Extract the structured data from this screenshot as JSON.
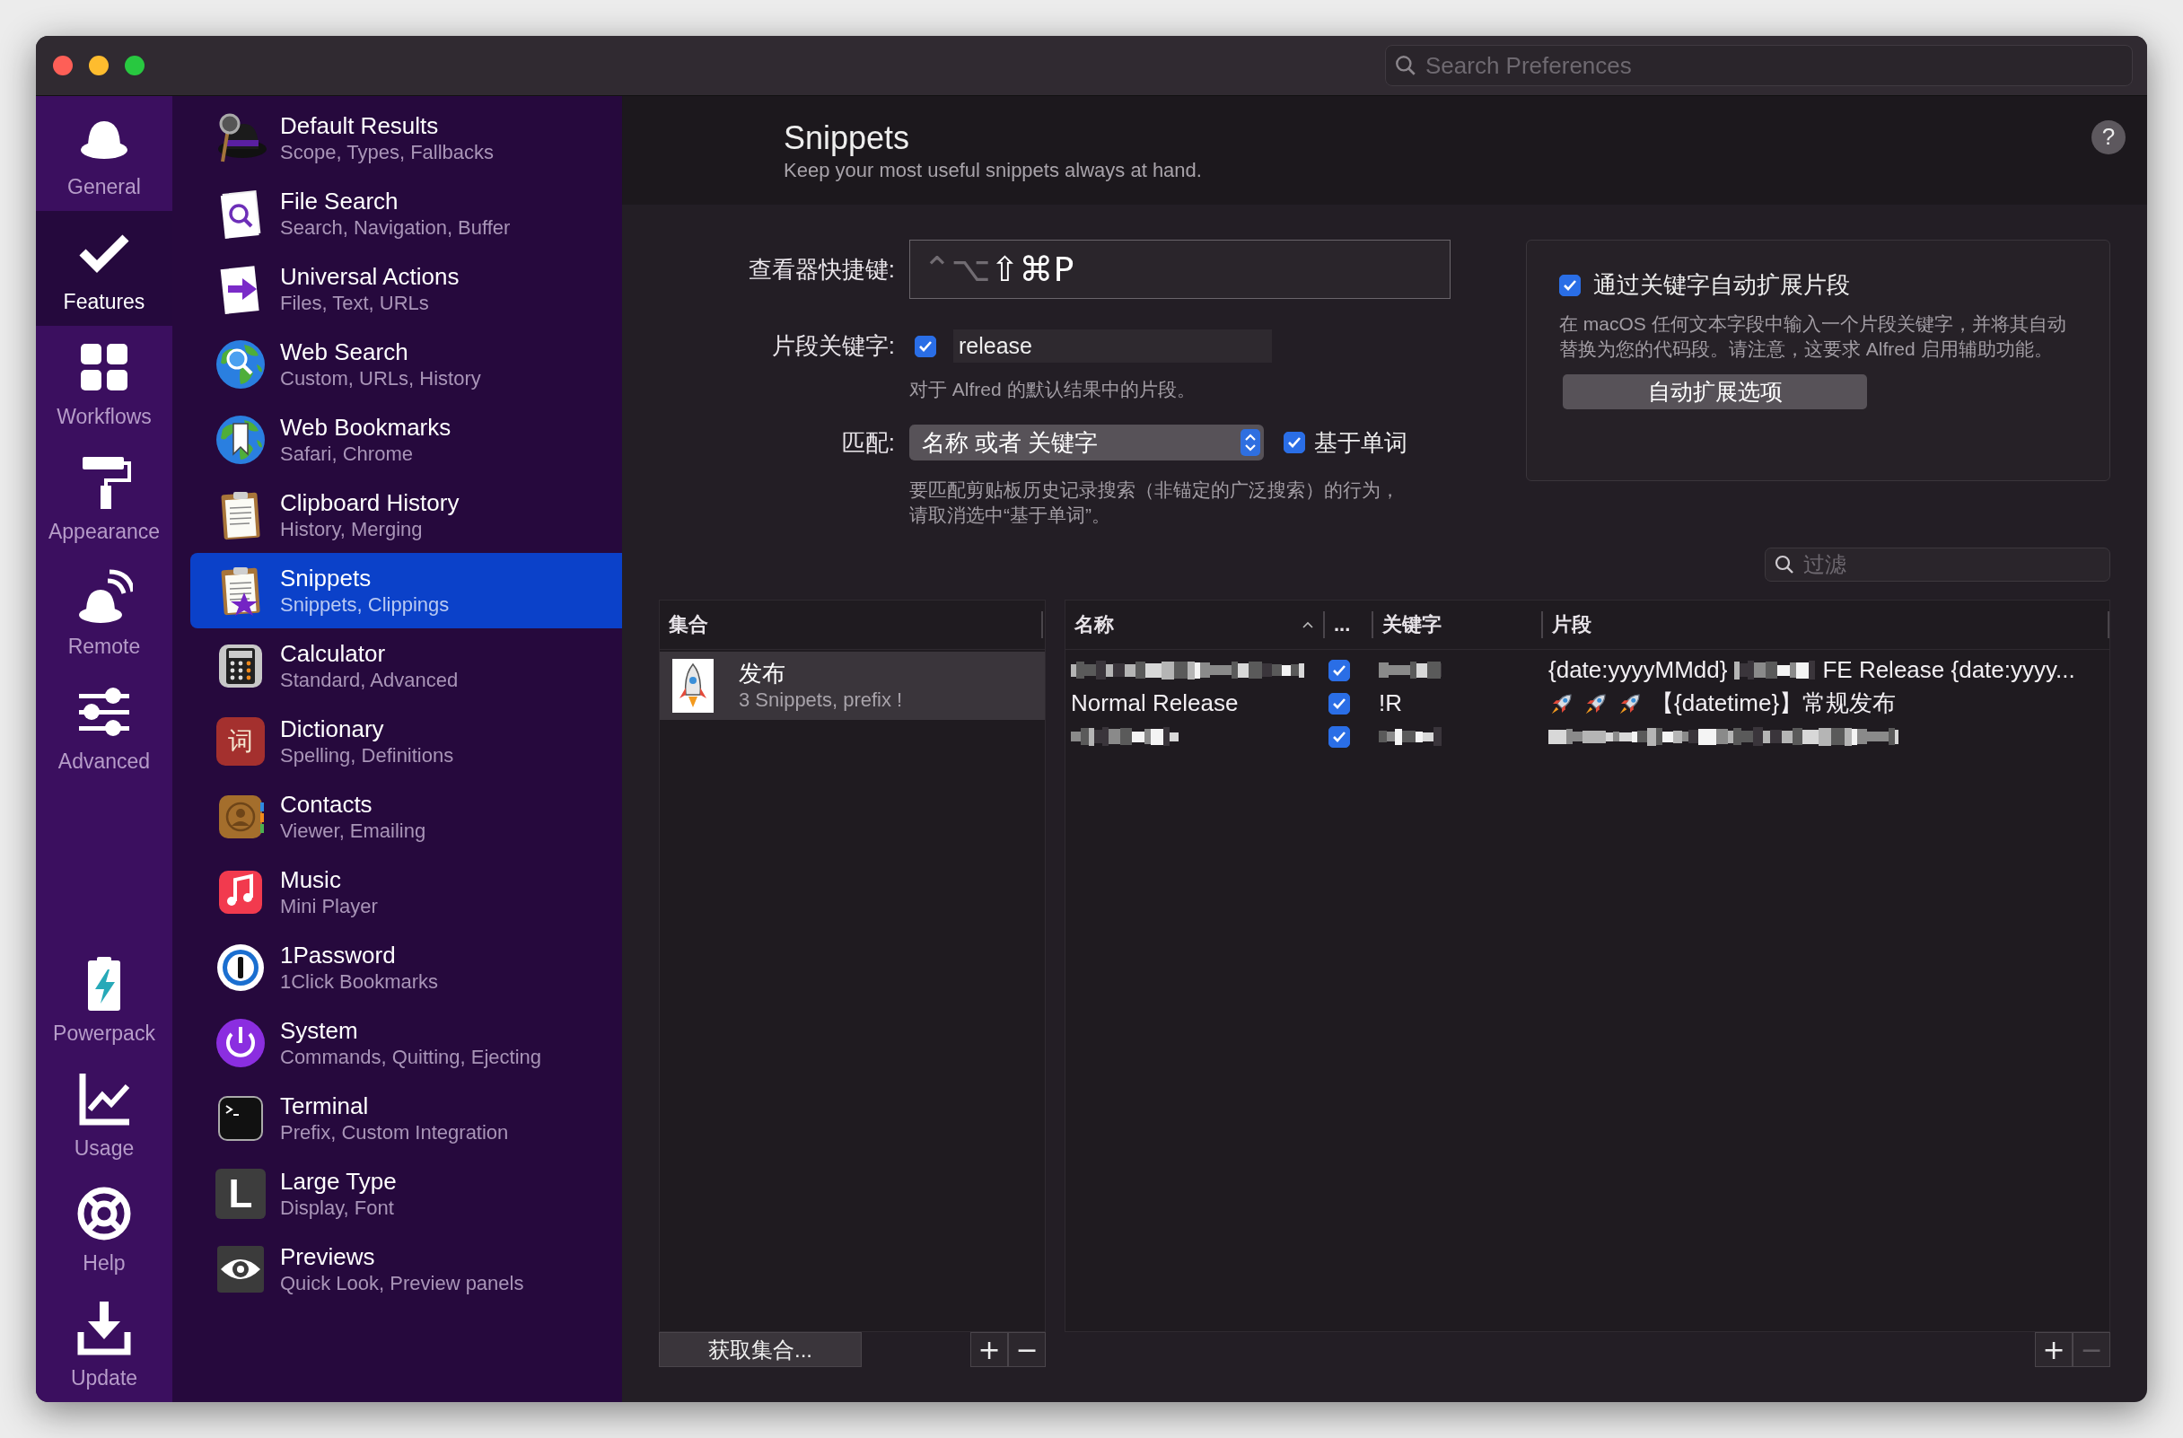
{
  "search": {
    "placeholder": "Search Preferences"
  },
  "rail_top": [
    {
      "label": "General",
      "selected": false
    },
    {
      "label": "Features",
      "selected": true
    },
    {
      "label": "Workflows",
      "selected": false
    },
    {
      "label": "Appearance",
      "selected": false
    },
    {
      "label": "Remote",
      "selected": false
    },
    {
      "label": "Advanced",
      "selected": false
    }
  ],
  "rail_bottom": [
    {
      "label": "Powerpack",
      "selected": false
    },
    {
      "label": "Usage",
      "selected": false
    },
    {
      "label": "Help",
      "selected": false
    },
    {
      "label": "Update",
      "selected": false
    }
  ],
  "features": [
    {
      "title": "Default Results",
      "subtitle": "Scope, Types, Fallbacks",
      "selected": false
    },
    {
      "title": "File Search",
      "subtitle": "Search, Navigation, Buffer",
      "selected": false
    },
    {
      "title": "Universal Actions",
      "subtitle": "Files, Text, URLs",
      "selected": false
    },
    {
      "title": "Web Search",
      "subtitle": "Custom, URLs, History",
      "selected": false
    },
    {
      "title": "Web Bookmarks",
      "subtitle": "Safari, Chrome",
      "selected": false
    },
    {
      "title": "Clipboard History",
      "subtitle": "History, Merging",
      "selected": false
    },
    {
      "title": "Snippets",
      "subtitle": "Snippets, Clippings",
      "selected": true
    },
    {
      "title": "Calculator",
      "subtitle": "Standard, Advanced",
      "selected": false
    },
    {
      "title": "Dictionary",
      "subtitle": "Spelling, Definitions",
      "selected": false,
      "badge": "词"
    },
    {
      "title": "Contacts",
      "subtitle": "Viewer, Emailing",
      "selected": false
    },
    {
      "title": "Music",
      "subtitle": "Mini Player",
      "selected": false
    },
    {
      "title": "1Password",
      "subtitle": "1Click Bookmarks",
      "selected": false
    },
    {
      "title": "System",
      "subtitle": "Commands, Quitting, Ejecting",
      "selected": false
    },
    {
      "title": "Terminal",
      "subtitle": "Prefix, Custom Integration",
      "selected": false
    },
    {
      "title": "Large Type",
      "subtitle": "Display, Font",
      "selected": false,
      "badge": "L"
    },
    {
      "title": "Previews",
      "subtitle": "Quick Look, Preview panels",
      "selected": false
    }
  ],
  "header": {
    "title": "Snippets",
    "subtitle": "Keep your most useful snippets always at hand.",
    "help": "?"
  },
  "form": {
    "hotkey": {
      "label": "查看器快捷键:",
      "keys": [
        {
          "key": "⌃",
          "active": false
        },
        {
          "key": "⌥",
          "active": false
        },
        {
          "key": "⇧",
          "active": true
        },
        {
          "key": "⌘",
          "active": true
        },
        {
          "key": "P",
          "active": true
        }
      ]
    },
    "keyword": {
      "label": "片段关键字:",
      "checked": true,
      "value": "release",
      "hint": "对于 Alfred 的默认结果中的片段。"
    },
    "match": {
      "label": "匹配:",
      "value": "名称 或者 关键字",
      "word_option": {
        "label": "基于单词",
        "checked": true
      },
      "hint": "要匹配剪贴板历史记录搜索（非锚定的广泛搜索）的行为，请取消选中“基于单词”。"
    }
  },
  "auto_expand": {
    "label": "通过关键字自动扩展片段",
    "checked": true,
    "description": "在 macOS 任何文本字段中输入一个片段关键字，并将其自动替换为您的代码段。请注意，这要求 Alfred 启用辅助功能。",
    "button": "自动扩展选项"
  },
  "filter": {
    "placeholder": "过滤"
  },
  "collections": {
    "header": "集合",
    "items": [
      {
        "name": "发布",
        "detail": "3 Snippets, prefix !",
        "selected": true
      }
    ],
    "button": "获取集合...",
    "add": {
      "label": "+",
      "disabled": false
    },
    "remove": {
      "label": "−",
      "disabled": false
    }
  },
  "snippets": {
    "columns": [
      {
        "label": "名称",
        "sorted": true
      },
      {
        "label": "...",
        "sorted": false
      },
      {
        "label": "关键字",
        "sorted": false
      },
      {
        "label": "片段",
        "sorted": false
      }
    ],
    "rows": [
      {
        "name": {
          "redacted": true
        },
        "checked": true,
        "keyword": {
          "redacted": true
        },
        "snippet": [
          {
            "kind": "text",
            "text": "{date:yyyyMMdd}"
          },
          {
            "kind": "redacted"
          },
          {
            "kind": "text",
            "text": "FE Release {date:yyyy..."
          }
        ]
      },
      {
        "name": {
          "redacted": false,
          "text": "Normal Release"
        },
        "checked": true,
        "keyword": {
          "redacted": false,
          "text": "!R"
        },
        "snippet": [
          {
            "kind": "rocket"
          },
          {
            "kind": "rocket"
          },
          {
            "kind": "rocket"
          },
          {
            "kind": "text",
            "text": "【{datetime}】常规发布"
          }
        ]
      },
      {
        "name": {
          "redacted": true
        },
        "checked": true,
        "keyword": {
          "redacted": true
        },
        "snippet": [
          {
            "kind": "redacted"
          }
        ]
      }
    ],
    "add": {
      "label": "+",
      "disabled": false
    },
    "remove": {
      "label": "−",
      "disabled": true
    }
  }
}
